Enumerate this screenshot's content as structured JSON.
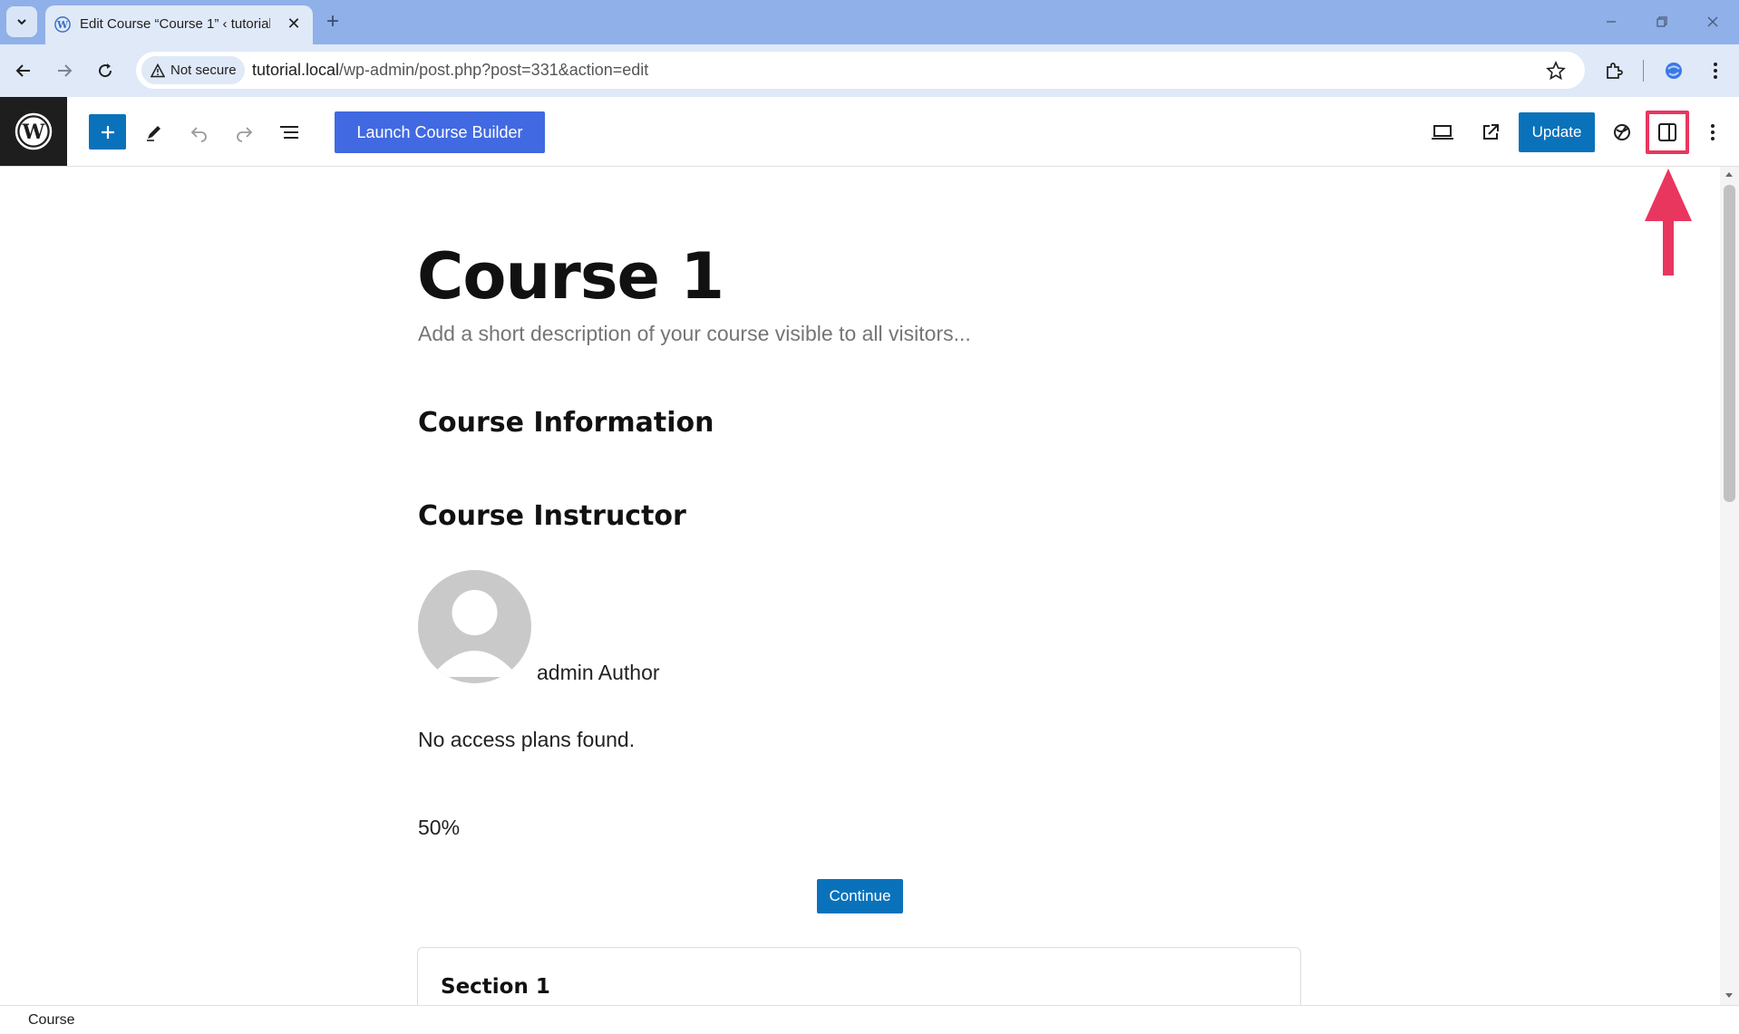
{
  "browser": {
    "tab_title": "Edit Course “Course 1” ‹ tutorial",
    "new_tab_symbol": "+",
    "close_symbol": "✕",
    "security_label": "Not secure",
    "url_host": "tutorial.local",
    "url_path": "/wp-admin/post.php?post=331&action=edit"
  },
  "editor": {
    "launch_button": "Launch Course Builder",
    "update_button": "Update",
    "highlight_color": "#e9365f",
    "accent_color": "#0a72ba"
  },
  "content": {
    "title": "Course 1",
    "description_placeholder": "Add a short description of your course visible to all visitors...",
    "heading_info": "Course Information",
    "heading_instructor": "Course Instructor",
    "author": "admin Author",
    "access_plans": "No access plans found.",
    "progress": "50%",
    "continue_button": "Continue",
    "section_title": "Section 1"
  },
  "footer": {
    "breadcrumb": "Course"
  }
}
